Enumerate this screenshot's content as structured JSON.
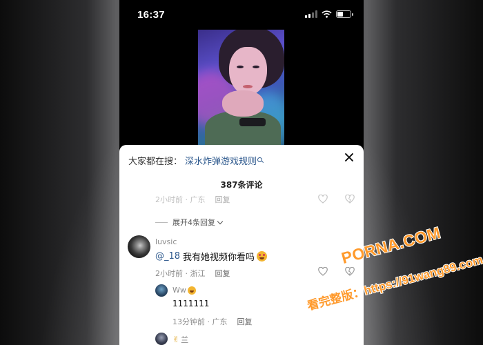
{
  "status_bar": {
    "time": "16:37",
    "battery_level": 0.45
  },
  "search": {
    "prefix": "大家都在搜：",
    "query": "深水炸弹游戏规则"
  },
  "comments_header": {
    "count_label": "387条评论"
  },
  "prev_comment": {
    "time": "2小时前 · 广东",
    "reply": "回复"
  },
  "expand": {
    "label": "展开4条回复"
  },
  "main_comment": {
    "username": "luvsic",
    "mention": "@_18",
    "text": "我有她视频你看吗",
    "time": "2小时前 · 浙江",
    "reply": "回复"
  },
  "sub_comment": {
    "username": "Ww",
    "text": "1111111",
    "time": "13分钟前 · 广东",
    "reply": "回复"
  },
  "sub_comment_2": {
    "username": "兰"
  },
  "watermark": {
    "line1": "PORNA.COM",
    "line2": "看完整版：https://91wang89.com"
  },
  "colors": {
    "link": "#2f5a8e",
    "watermark": "#ff9a2c"
  }
}
